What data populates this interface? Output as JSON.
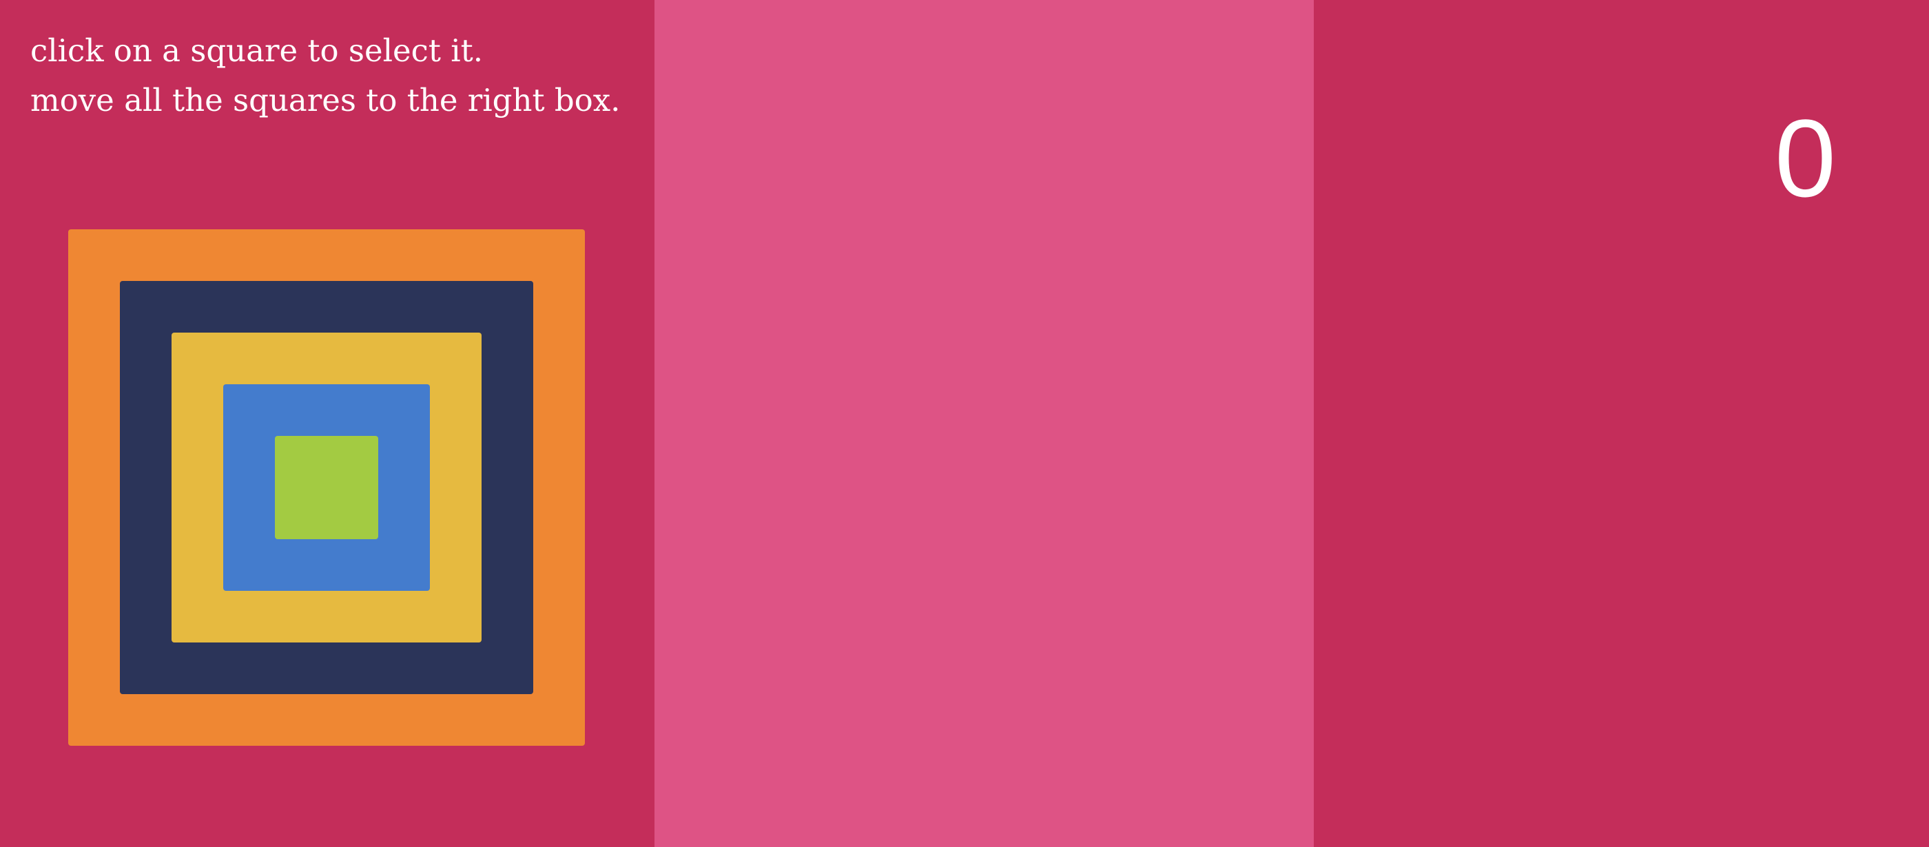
{
  "instructions": {
    "line1": "click on a square to select it.",
    "line2": "move all the squares to the right box."
  },
  "move_counter": "0",
  "colors": {
    "left_column": "#c42d5a",
    "middle_column": "#de5385",
    "right_column": "#c42d5a"
  },
  "columns": [
    "left",
    "middle",
    "right"
  ],
  "stacks": {
    "left": [
      "orange",
      "navy",
      "yellow",
      "blue",
      "green"
    ],
    "middle": [],
    "right": []
  },
  "squares": [
    {
      "name": "orange",
      "color": "#ef8733"
    },
    {
      "name": "navy",
      "color": "#2b3459"
    },
    {
      "name": "yellow",
      "color": "#e6ba40"
    },
    {
      "name": "blue",
      "color": "#447ccd"
    },
    {
      "name": "green",
      "color": "#a3cb42"
    }
  ]
}
